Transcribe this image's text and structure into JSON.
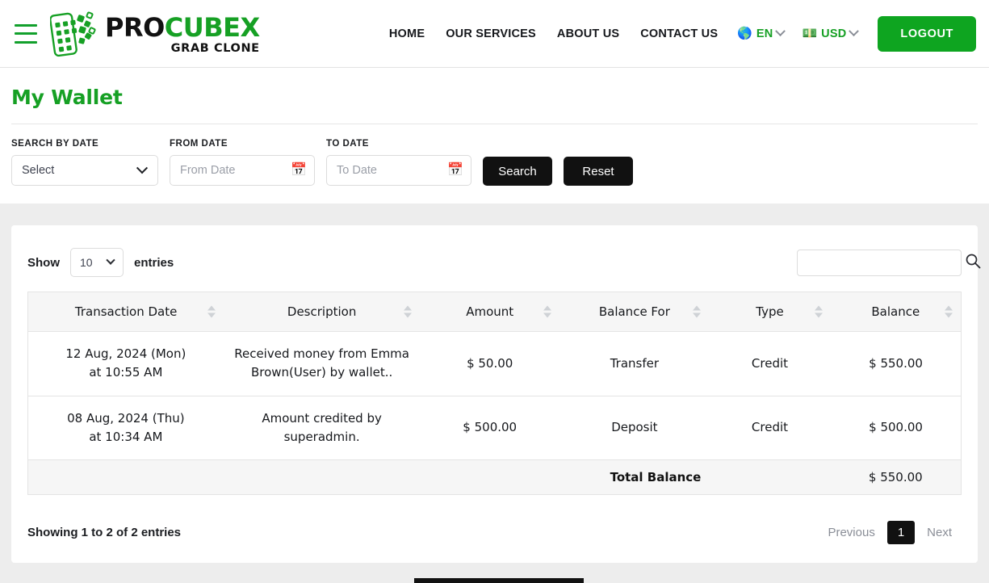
{
  "header": {
    "menu_icon": "hamburger-icon",
    "logo": {
      "part1": "PRO",
      "part2": "CUBEX",
      "tagline": "GRAB CLONE"
    },
    "nav": [
      {
        "label": "HOME"
      },
      {
        "label": "OUR SERVICES"
      },
      {
        "label": "ABOUT US"
      },
      {
        "label": "CONTACT US"
      }
    ],
    "language": {
      "icon": "globe-icon",
      "emoji": "🌎",
      "label": "EN"
    },
    "currency": {
      "icon": "money-icon",
      "emoji": "💵",
      "label": "USD"
    },
    "logout_label": "LOGOUT",
    "brand_green": "#16a024"
  },
  "page": {
    "title": "My Wallet",
    "filters": {
      "search_by_date_label": "SEARCH BY DATE",
      "search_by_date_value": "Select",
      "from_date_label": "FROM DATE",
      "from_date_placeholder": "From Date",
      "from_date_value": "",
      "to_date_label": "TO DATE",
      "to_date_placeholder": "To Date",
      "to_date_value": "",
      "calendar_icon": "📅",
      "search_button": "Search",
      "reset_button": "Reset"
    }
  },
  "table": {
    "show_label": "Show",
    "entries_label": "entries",
    "page_length": "10",
    "search_value": "",
    "search_placeholder": "",
    "columns": [
      "Transaction Date",
      "Description",
      "Amount",
      "Balance For",
      "Type",
      "Balance"
    ],
    "rows": [
      {
        "date_line1": "12 Aug, 2024 (Mon)",
        "date_line2": "at 10:55 AM",
        "description": "Received money from Emma Brown(User) by wallet..",
        "amount": "$ 50.00",
        "balance_for": "Transfer",
        "type": "Credit",
        "balance": "$ 550.00"
      },
      {
        "date_line1": "08 Aug, 2024 (Thu)",
        "date_line2": "at 10:34 AM",
        "description": "Amount credited by superadmin.",
        "amount": "$ 500.00",
        "balance_for": "Deposit",
        "type": "Credit",
        "balance": "$ 500.00"
      }
    ],
    "total_label": "Total Balance",
    "total_value": "$ 550.00",
    "info": "Showing 1 to 2 of 2 entries",
    "pagination": {
      "previous": "Previous",
      "current": "1",
      "next": "Next"
    }
  }
}
